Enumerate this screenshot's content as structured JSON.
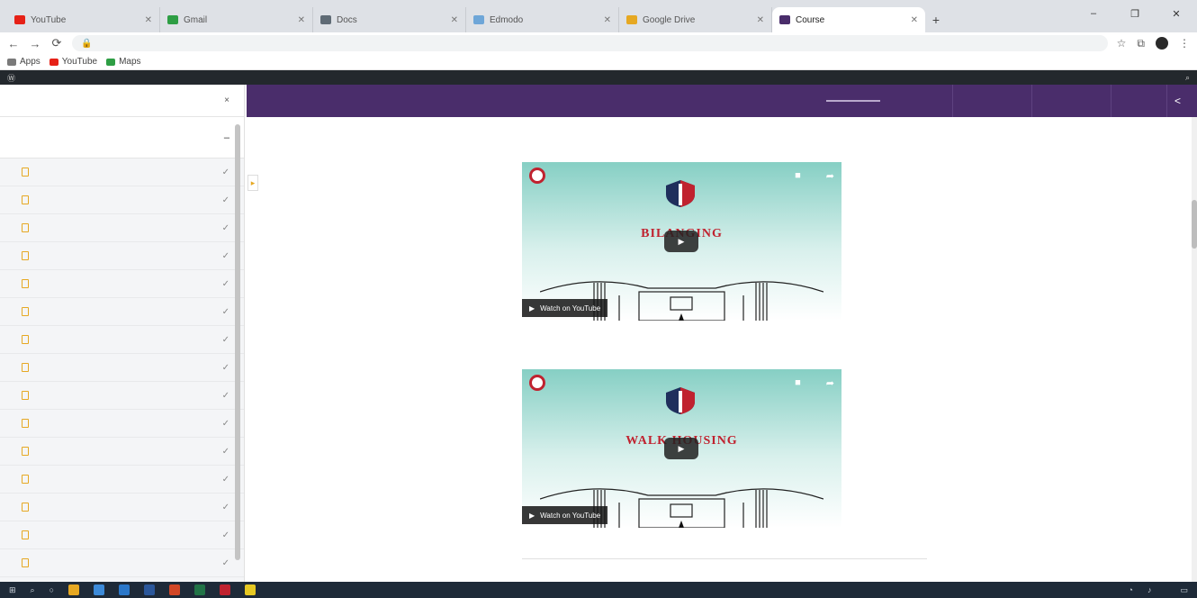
{
  "browser": {
    "tabs": [
      {
        "title": "YouTube",
        "color": "#e62117"
      },
      {
        "title": "Gmail",
        "color": "#2e9e44"
      },
      {
        "title": "Docs",
        "color": "#5f6b75"
      },
      {
        "title": "Edmodo",
        "color": "#6ea6d8"
      },
      {
        "title": "Google Drive",
        "color": "#e6a822"
      },
      {
        "title": "Course",
        "color": "#4a2d6b",
        "active": true
      }
    ],
    "new_tab": "+",
    "window_controls": [
      "–",
      "❐",
      "✕"
    ],
    "nav": {
      "back": "←",
      "forward": "→",
      "reload": "⟳"
    },
    "url": "",
    "bookmarks": [
      {
        "label": "Apps",
        "color": "#7a7a7a"
      },
      {
        "label": "YouTube",
        "color": "#e62117"
      },
      {
        "label": "Maps",
        "color": "#2e9e44"
      }
    ]
  },
  "wp_admin": {
    "left": "",
    "right": ""
  },
  "sidebar": {
    "header": "",
    "collapse_icon": "×",
    "section_title": "",
    "section_toggle": "–",
    "lessons": [
      "",
      "",
      "",
      "",
      "",
      "",
      "",
      "",
      "",
      "",
      "",
      "",
      "",
      "",
      ""
    ]
  },
  "course_bar": {
    "title": "",
    "progress_label": "",
    "next_icon": "<"
  },
  "content": {
    "videos": [
      {
        "caption_top": "",
        "caption": "",
        "word": "BILANGING",
        "watch": "Watch on YouTube"
      },
      {
        "caption_top": "",
        "caption": "",
        "word": "WALK HOUSING",
        "watch": "Watch on YouTube"
      }
    ],
    "bottom_caption": "",
    "prev": "",
    "next": ""
  },
  "taskbar": {
    "clock_time": "",
    "clock_date": ""
  },
  "colors": {
    "brand_purple": "#4a2d6b",
    "accent": "#e6a822",
    "crest_red": "#c0222f"
  }
}
